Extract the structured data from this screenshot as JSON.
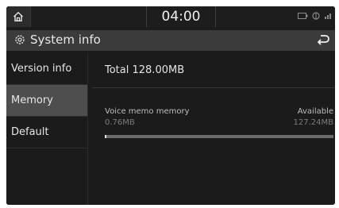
{
  "status_bar": {
    "time": "04:00",
    "icons": [
      "home-icon",
      "media-status-icon",
      "connectivity-icon",
      "signal-icon"
    ]
  },
  "title_bar": {
    "title": "System info",
    "icon": "gear-icon",
    "back_icon": "back-icon"
  },
  "sidebar": {
    "items": [
      {
        "label": "Version info",
        "selected": false
      },
      {
        "label": "Memory",
        "selected": true
      },
      {
        "label": "Default",
        "selected": false
      }
    ]
  },
  "main": {
    "total": "Total 128.00MB",
    "memory_label": "Voice memo memory",
    "available_label": "Available",
    "used_value": "0.76MB",
    "available_value": "127.24MB",
    "usage_fraction": 0.006
  },
  "colors": {
    "background": "#1b1b1b",
    "titlebar": "#3b3b3b",
    "selected_item": "#4e4e4e",
    "text": "#e6e6e6"
  }
}
